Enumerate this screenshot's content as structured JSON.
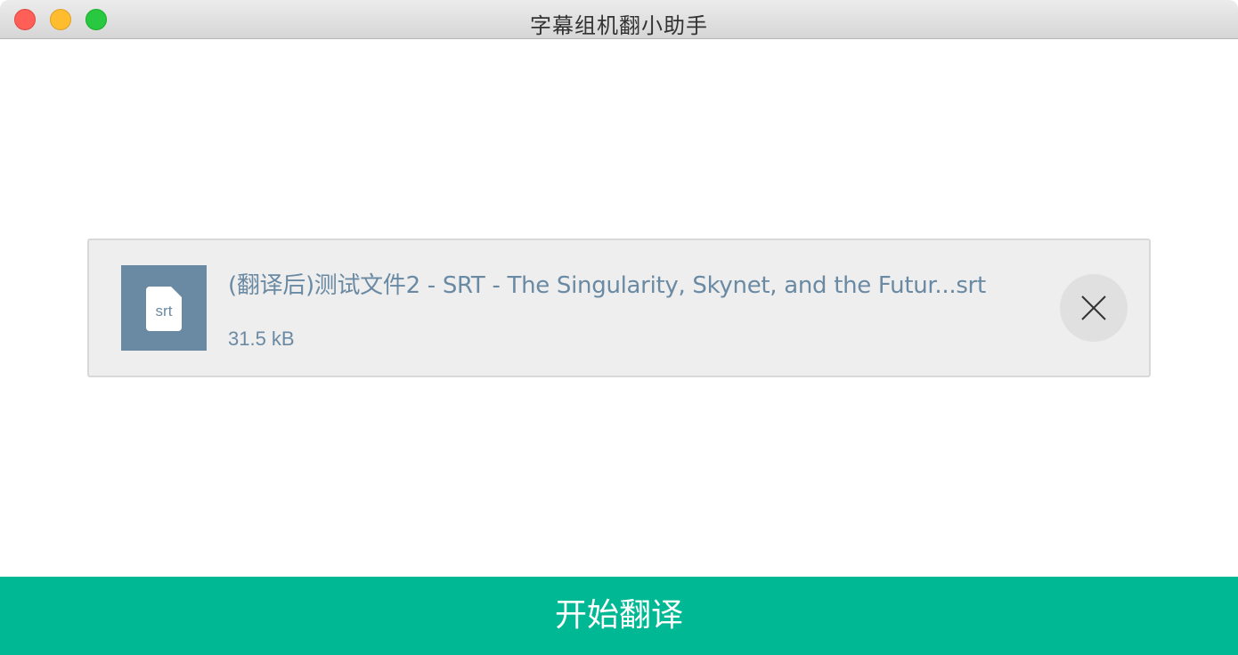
{
  "window": {
    "title": "字幕组机翻小助手"
  },
  "file": {
    "icon_label": "srt",
    "name": "(翻译后)测试文件2 - SRT - The Singularity, Skynet, and the Futur...srt",
    "size": "31.5 kB"
  },
  "actions": {
    "start_label": "开始翻译"
  },
  "icons": {
    "remove": "close-icon",
    "file": "file-icon"
  },
  "colors": {
    "accent": "#00b994",
    "file_text": "#6a8aa3",
    "card_bg": "#eeeeee"
  }
}
